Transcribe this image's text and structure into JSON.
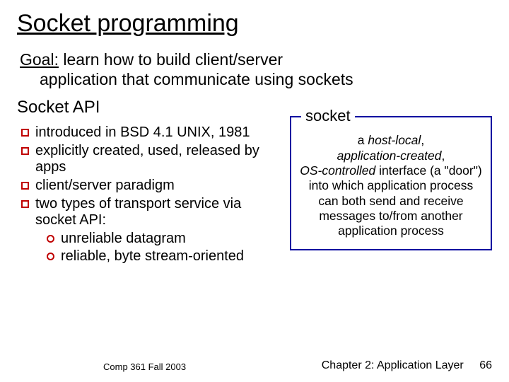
{
  "title": "Socket programming",
  "goal": {
    "label": "Goal:",
    "text_line1": " learn how to build client/server",
    "text_line2": "application that communicate using sockets"
  },
  "api_heading": "Socket API",
  "bullets": [
    "introduced in BSD 4.1 UNIX, 1981",
    "explicitly created, used, released by apps",
    "client/server paradigm",
    "two types of transport service via socket API:"
  ],
  "sub_bullets": [
    "unreliable datagram",
    "reliable, byte stream-oriented"
  ],
  "socket": {
    "label": "socket",
    "l1_pre": "a ",
    "l1_em": "host-local",
    "l1_post": ",",
    "l2_em": "application-created",
    "l2_post": ",",
    "l3_em": "OS-controlled",
    "l3_post": " interface (a \"door\") into which application process can both send and receive messages to/from another application process"
  },
  "footer": {
    "left": "Comp 361   Fall 2003",
    "right": "Chapter 2: Application Layer",
    "page": "66"
  }
}
